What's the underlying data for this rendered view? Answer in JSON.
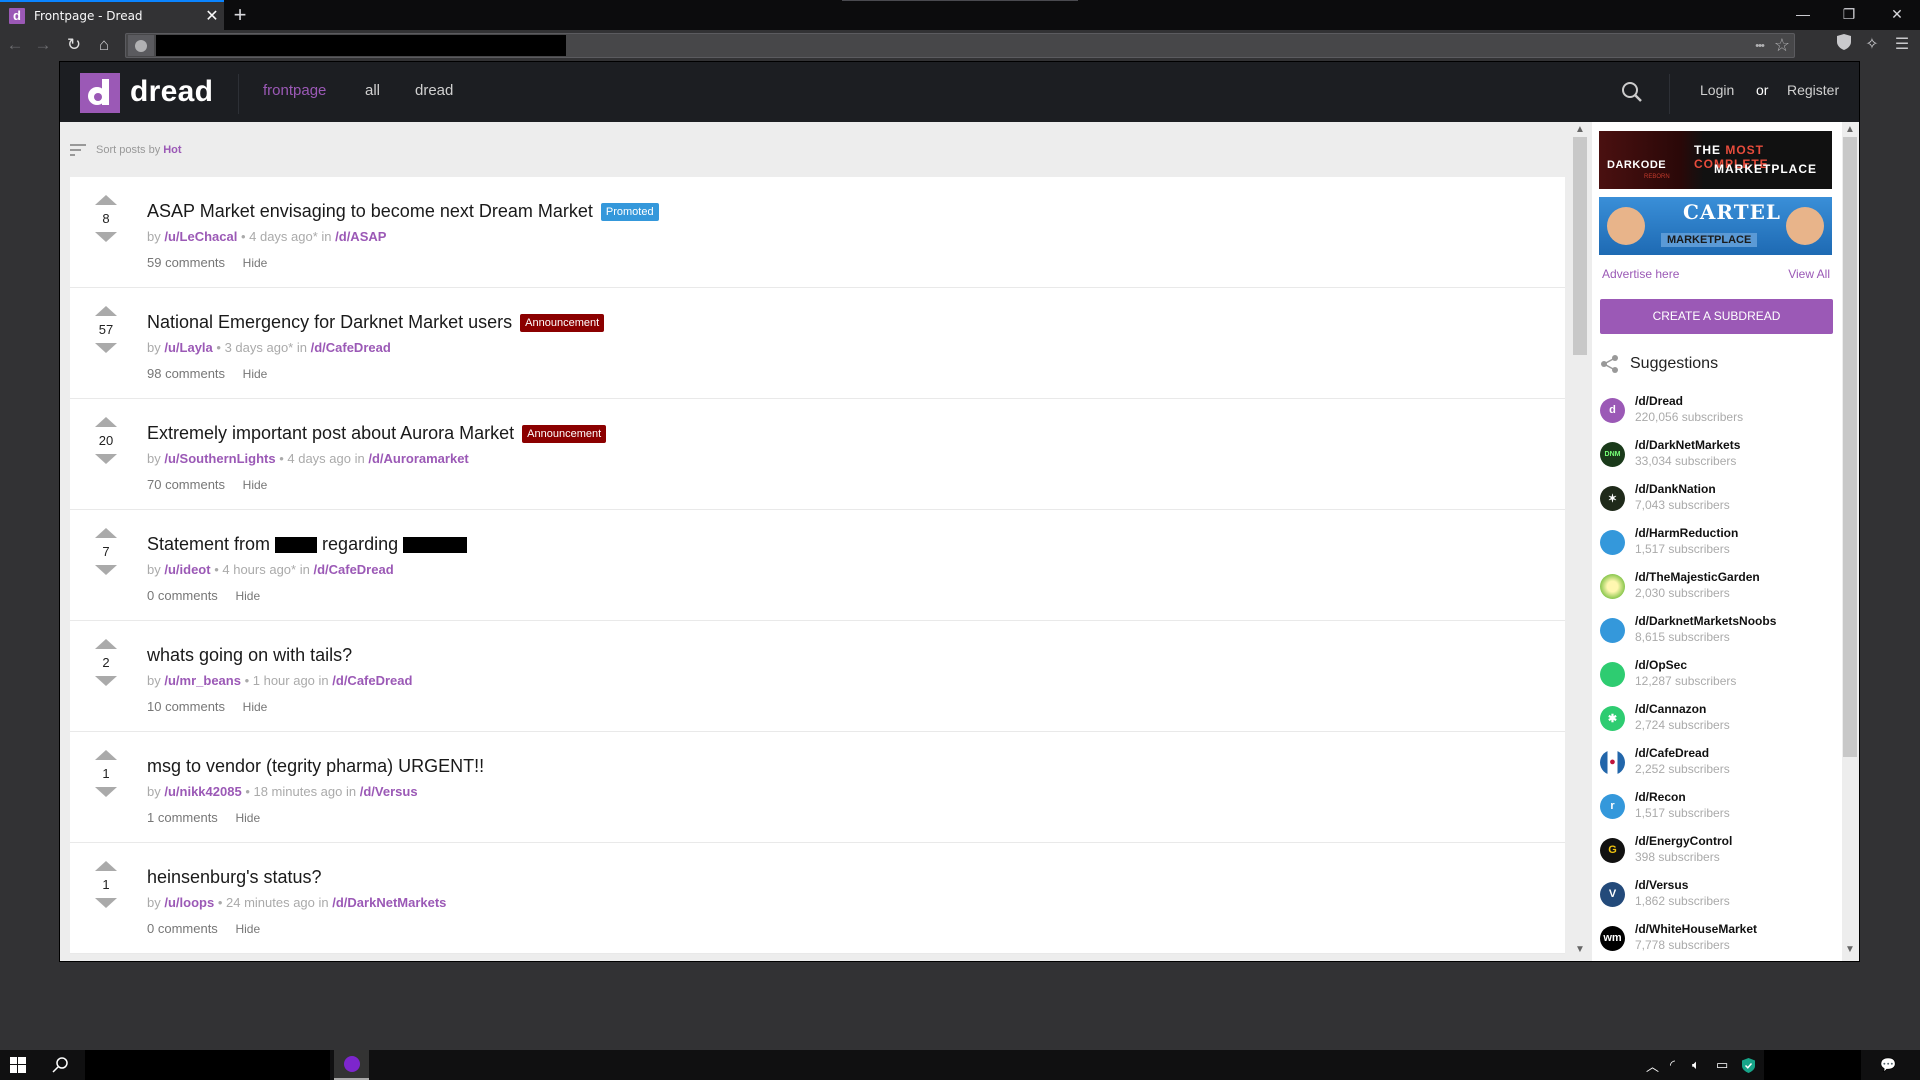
{
  "browser": {
    "tab_title": "Frontpage - Dread",
    "tab_favicon": "d",
    "new_tab_label": "+",
    "window_controls": {
      "minimize": "—",
      "restore": "❐",
      "close": "✕"
    },
    "nav": {
      "back": "←",
      "forward": "→",
      "reload": "↻",
      "home": "⌂"
    },
    "url_actions": {
      "more": "•••",
      "bookmark": "☆"
    },
    "toolbar_icons": [
      "shield-icon",
      "cleaner-icon",
      "menu-icon"
    ]
  },
  "header": {
    "logo_letter": "d",
    "logo_text": "dread",
    "nav": [
      {
        "label": "frontpage",
        "active": true
      },
      {
        "label": "all",
        "active": false
      },
      {
        "label": "dread",
        "active": false
      }
    ],
    "login": "Login",
    "or": "or",
    "register": "Register"
  },
  "sort": {
    "prefix": "Sort posts by",
    "value": "Hot"
  },
  "posts": [
    {
      "score": "8",
      "title": "ASAP Market envisaging to become next Dream Market",
      "badge": "Promoted",
      "badge_type": "promoted",
      "by": "by",
      "author": "/u/LeChacal",
      "time": "• 4 days ago* in",
      "sub": "/d/ASAP",
      "comments": "59 comments",
      "hide": "Hide"
    },
    {
      "score": "57",
      "title": "National Emergency for Darknet Market users",
      "badge": "Announcement",
      "badge_type": "announcement",
      "by": "by",
      "author": "/u/Layla",
      "time": "• 3 days ago* in",
      "sub": "/d/CafeDread",
      "comments": "98 comments",
      "hide": "Hide"
    },
    {
      "score": "20",
      "title": "Extremely important post about Aurora Market",
      "badge": "Announcement",
      "badge_type": "announcement",
      "by": "by",
      "author": "/u/SouthernLights",
      "time": "• 4 days ago in",
      "sub": "/d/Auroramarket",
      "comments": "70 comments",
      "hide": "Hide"
    },
    {
      "score": "7",
      "title_parts": [
        "Statement from",
        "regarding"
      ],
      "redacted": true,
      "by": "by",
      "author": "/u/ideot",
      "time": "• 4 hours ago* in",
      "sub": "/d/CafeDread",
      "comments": "0 comments",
      "hide": "Hide"
    },
    {
      "score": "2",
      "title": "whats going on with tails?",
      "by": "by",
      "author": "/u/mr_beans",
      "time": "• 1 hour ago in",
      "sub": "/d/CafeDread",
      "comments": "10 comments",
      "hide": "Hide"
    },
    {
      "score": "1",
      "title": "msg to vendor (tegrity pharma) URGENT!!",
      "by": "by",
      "author": "/u/nikk42085",
      "time": "• 18 minutes ago in",
      "sub": "/d/Versus",
      "comments": "1 comments",
      "hide": "Hide"
    },
    {
      "score": "1",
      "title": "heinsenburg's status?",
      "by": "by",
      "author": "/u/loops",
      "time": "• 24 minutes ago in",
      "sub": "/d/DarkNetMarkets",
      "comments": "0 comments",
      "hide": "Hide"
    }
  ],
  "sidebar": {
    "ads": [
      {
        "brand": "DARKODE",
        "sub": "REBORN",
        "line1a": "THE ",
        "line1b": "MOST COMPLETE",
        "line2": "MARKETPLACE"
      },
      {
        "brand": "CARTEL",
        "sub": "MARKETPLACE"
      }
    ],
    "advertise_here": "Advertise here",
    "view_all": "View All",
    "create_button": "CREATE A SUBDREAD",
    "suggestions_title": "Suggestions",
    "suggestions": [
      {
        "name": "/d/Dread",
        "subs": "220,056 subscribers",
        "icon_color": "#9b59b6",
        "icon_text": "d"
      },
      {
        "name": "/d/DarkNetMarkets",
        "subs": "33,034 subscribers",
        "icon_color": "#1a3a1a",
        "icon_text": "DNM"
      },
      {
        "name": "/d/DankNation",
        "subs": "7,043 subscribers",
        "icon_color": "#1f2a1a",
        "icon_text": "✶"
      },
      {
        "name": "/d/HarmReduction",
        "subs": "1,517 subscribers",
        "icon_color": "#3498db",
        "icon_text": ""
      },
      {
        "name": "/d/TheMajesticGarden",
        "subs": "2,030 subscribers",
        "icon_color": "#7bc142",
        "icon_text": ""
      },
      {
        "name": "/d/DarknetMarketsNoobs",
        "subs": "8,615 subscribers",
        "icon_color": "#3498db",
        "icon_text": ""
      },
      {
        "name": "/d/OpSec",
        "subs": "12,287 subscribers",
        "icon_color": "#2ecc71",
        "icon_text": ""
      },
      {
        "name": "/d/Cannazon",
        "subs": "2,724 subscribers",
        "icon_color": "#2ecc71",
        "icon_text": "✱"
      },
      {
        "name": "/d/CafeDread",
        "subs": "2,252 subscribers",
        "icon_color": "#2266aa",
        "icon_text": "●"
      },
      {
        "name": "/d/Recon",
        "subs": "1,517 subscribers",
        "icon_color": "#3498db",
        "icon_text": "r"
      },
      {
        "name": "/d/EnergyControl",
        "subs": "398 subscribers",
        "icon_color": "#111111",
        "icon_text": "G"
      },
      {
        "name": "/d/Versus",
        "subs": "1,862 subscribers",
        "icon_color": "#234a7a",
        "icon_text": "V"
      },
      {
        "name": "/d/WhiteHouseMarket",
        "subs": "7,778 subscribers",
        "icon_color": "#000000",
        "icon_text": "wm"
      }
    ]
  },
  "colors": {
    "accent": "#9b59b6",
    "promoted": "#3498db",
    "announcement": "#8b0000",
    "header_bg": "#1c1e22"
  },
  "taskbar": {
    "notification_icon": "💬"
  }
}
